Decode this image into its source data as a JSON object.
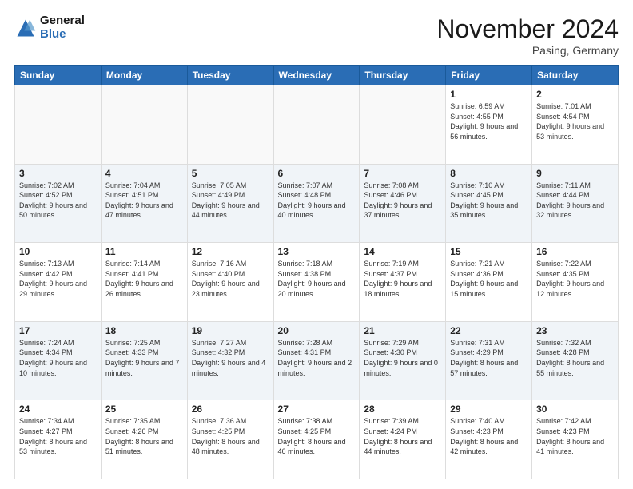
{
  "logo": {
    "general": "General",
    "blue": "Blue"
  },
  "header": {
    "month": "November 2024",
    "location": "Pasing, Germany"
  },
  "weekdays": [
    "Sunday",
    "Monday",
    "Tuesday",
    "Wednesday",
    "Thursday",
    "Friday",
    "Saturday"
  ],
  "weeks": [
    [
      {
        "day": "",
        "info": ""
      },
      {
        "day": "",
        "info": ""
      },
      {
        "day": "",
        "info": ""
      },
      {
        "day": "",
        "info": ""
      },
      {
        "day": "",
        "info": ""
      },
      {
        "day": "1",
        "info": "Sunrise: 6:59 AM\nSunset: 4:55 PM\nDaylight: 9 hours and 56 minutes."
      },
      {
        "day": "2",
        "info": "Sunrise: 7:01 AM\nSunset: 4:54 PM\nDaylight: 9 hours and 53 minutes."
      }
    ],
    [
      {
        "day": "3",
        "info": "Sunrise: 7:02 AM\nSunset: 4:52 PM\nDaylight: 9 hours and 50 minutes."
      },
      {
        "day": "4",
        "info": "Sunrise: 7:04 AM\nSunset: 4:51 PM\nDaylight: 9 hours and 47 minutes."
      },
      {
        "day": "5",
        "info": "Sunrise: 7:05 AM\nSunset: 4:49 PM\nDaylight: 9 hours and 44 minutes."
      },
      {
        "day": "6",
        "info": "Sunrise: 7:07 AM\nSunset: 4:48 PM\nDaylight: 9 hours and 40 minutes."
      },
      {
        "day": "7",
        "info": "Sunrise: 7:08 AM\nSunset: 4:46 PM\nDaylight: 9 hours and 37 minutes."
      },
      {
        "day": "8",
        "info": "Sunrise: 7:10 AM\nSunset: 4:45 PM\nDaylight: 9 hours and 35 minutes."
      },
      {
        "day": "9",
        "info": "Sunrise: 7:11 AM\nSunset: 4:44 PM\nDaylight: 9 hours and 32 minutes."
      }
    ],
    [
      {
        "day": "10",
        "info": "Sunrise: 7:13 AM\nSunset: 4:42 PM\nDaylight: 9 hours and 29 minutes."
      },
      {
        "day": "11",
        "info": "Sunrise: 7:14 AM\nSunset: 4:41 PM\nDaylight: 9 hours and 26 minutes."
      },
      {
        "day": "12",
        "info": "Sunrise: 7:16 AM\nSunset: 4:40 PM\nDaylight: 9 hours and 23 minutes."
      },
      {
        "day": "13",
        "info": "Sunrise: 7:18 AM\nSunset: 4:38 PM\nDaylight: 9 hours and 20 minutes."
      },
      {
        "day": "14",
        "info": "Sunrise: 7:19 AM\nSunset: 4:37 PM\nDaylight: 9 hours and 18 minutes."
      },
      {
        "day": "15",
        "info": "Sunrise: 7:21 AM\nSunset: 4:36 PM\nDaylight: 9 hours and 15 minutes."
      },
      {
        "day": "16",
        "info": "Sunrise: 7:22 AM\nSunset: 4:35 PM\nDaylight: 9 hours and 12 minutes."
      }
    ],
    [
      {
        "day": "17",
        "info": "Sunrise: 7:24 AM\nSunset: 4:34 PM\nDaylight: 9 hours and 10 minutes."
      },
      {
        "day": "18",
        "info": "Sunrise: 7:25 AM\nSunset: 4:33 PM\nDaylight: 9 hours and 7 minutes."
      },
      {
        "day": "19",
        "info": "Sunrise: 7:27 AM\nSunset: 4:32 PM\nDaylight: 9 hours and 4 minutes."
      },
      {
        "day": "20",
        "info": "Sunrise: 7:28 AM\nSunset: 4:31 PM\nDaylight: 9 hours and 2 minutes."
      },
      {
        "day": "21",
        "info": "Sunrise: 7:29 AM\nSunset: 4:30 PM\nDaylight: 9 hours and 0 minutes."
      },
      {
        "day": "22",
        "info": "Sunrise: 7:31 AM\nSunset: 4:29 PM\nDaylight: 8 hours and 57 minutes."
      },
      {
        "day": "23",
        "info": "Sunrise: 7:32 AM\nSunset: 4:28 PM\nDaylight: 8 hours and 55 minutes."
      }
    ],
    [
      {
        "day": "24",
        "info": "Sunrise: 7:34 AM\nSunset: 4:27 PM\nDaylight: 8 hours and 53 minutes."
      },
      {
        "day": "25",
        "info": "Sunrise: 7:35 AM\nSunset: 4:26 PM\nDaylight: 8 hours and 51 minutes."
      },
      {
        "day": "26",
        "info": "Sunrise: 7:36 AM\nSunset: 4:25 PM\nDaylight: 8 hours and 48 minutes."
      },
      {
        "day": "27",
        "info": "Sunrise: 7:38 AM\nSunset: 4:25 PM\nDaylight: 8 hours and 46 minutes."
      },
      {
        "day": "28",
        "info": "Sunrise: 7:39 AM\nSunset: 4:24 PM\nDaylight: 8 hours and 44 minutes."
      },
      {
        "day": "29",
        "info": "Sunrise: 7:40 AM\nSunset: 4:23 PM\nDaylight: 8 hours and 42 minutes."
      },
      {
        "day": "30",
        "info": "Sunrise: 7:42 AM\nSunset: 4:23 PM\nDaylight: 8 hours and 41 minutes."
      }
    ]
  ]
}
